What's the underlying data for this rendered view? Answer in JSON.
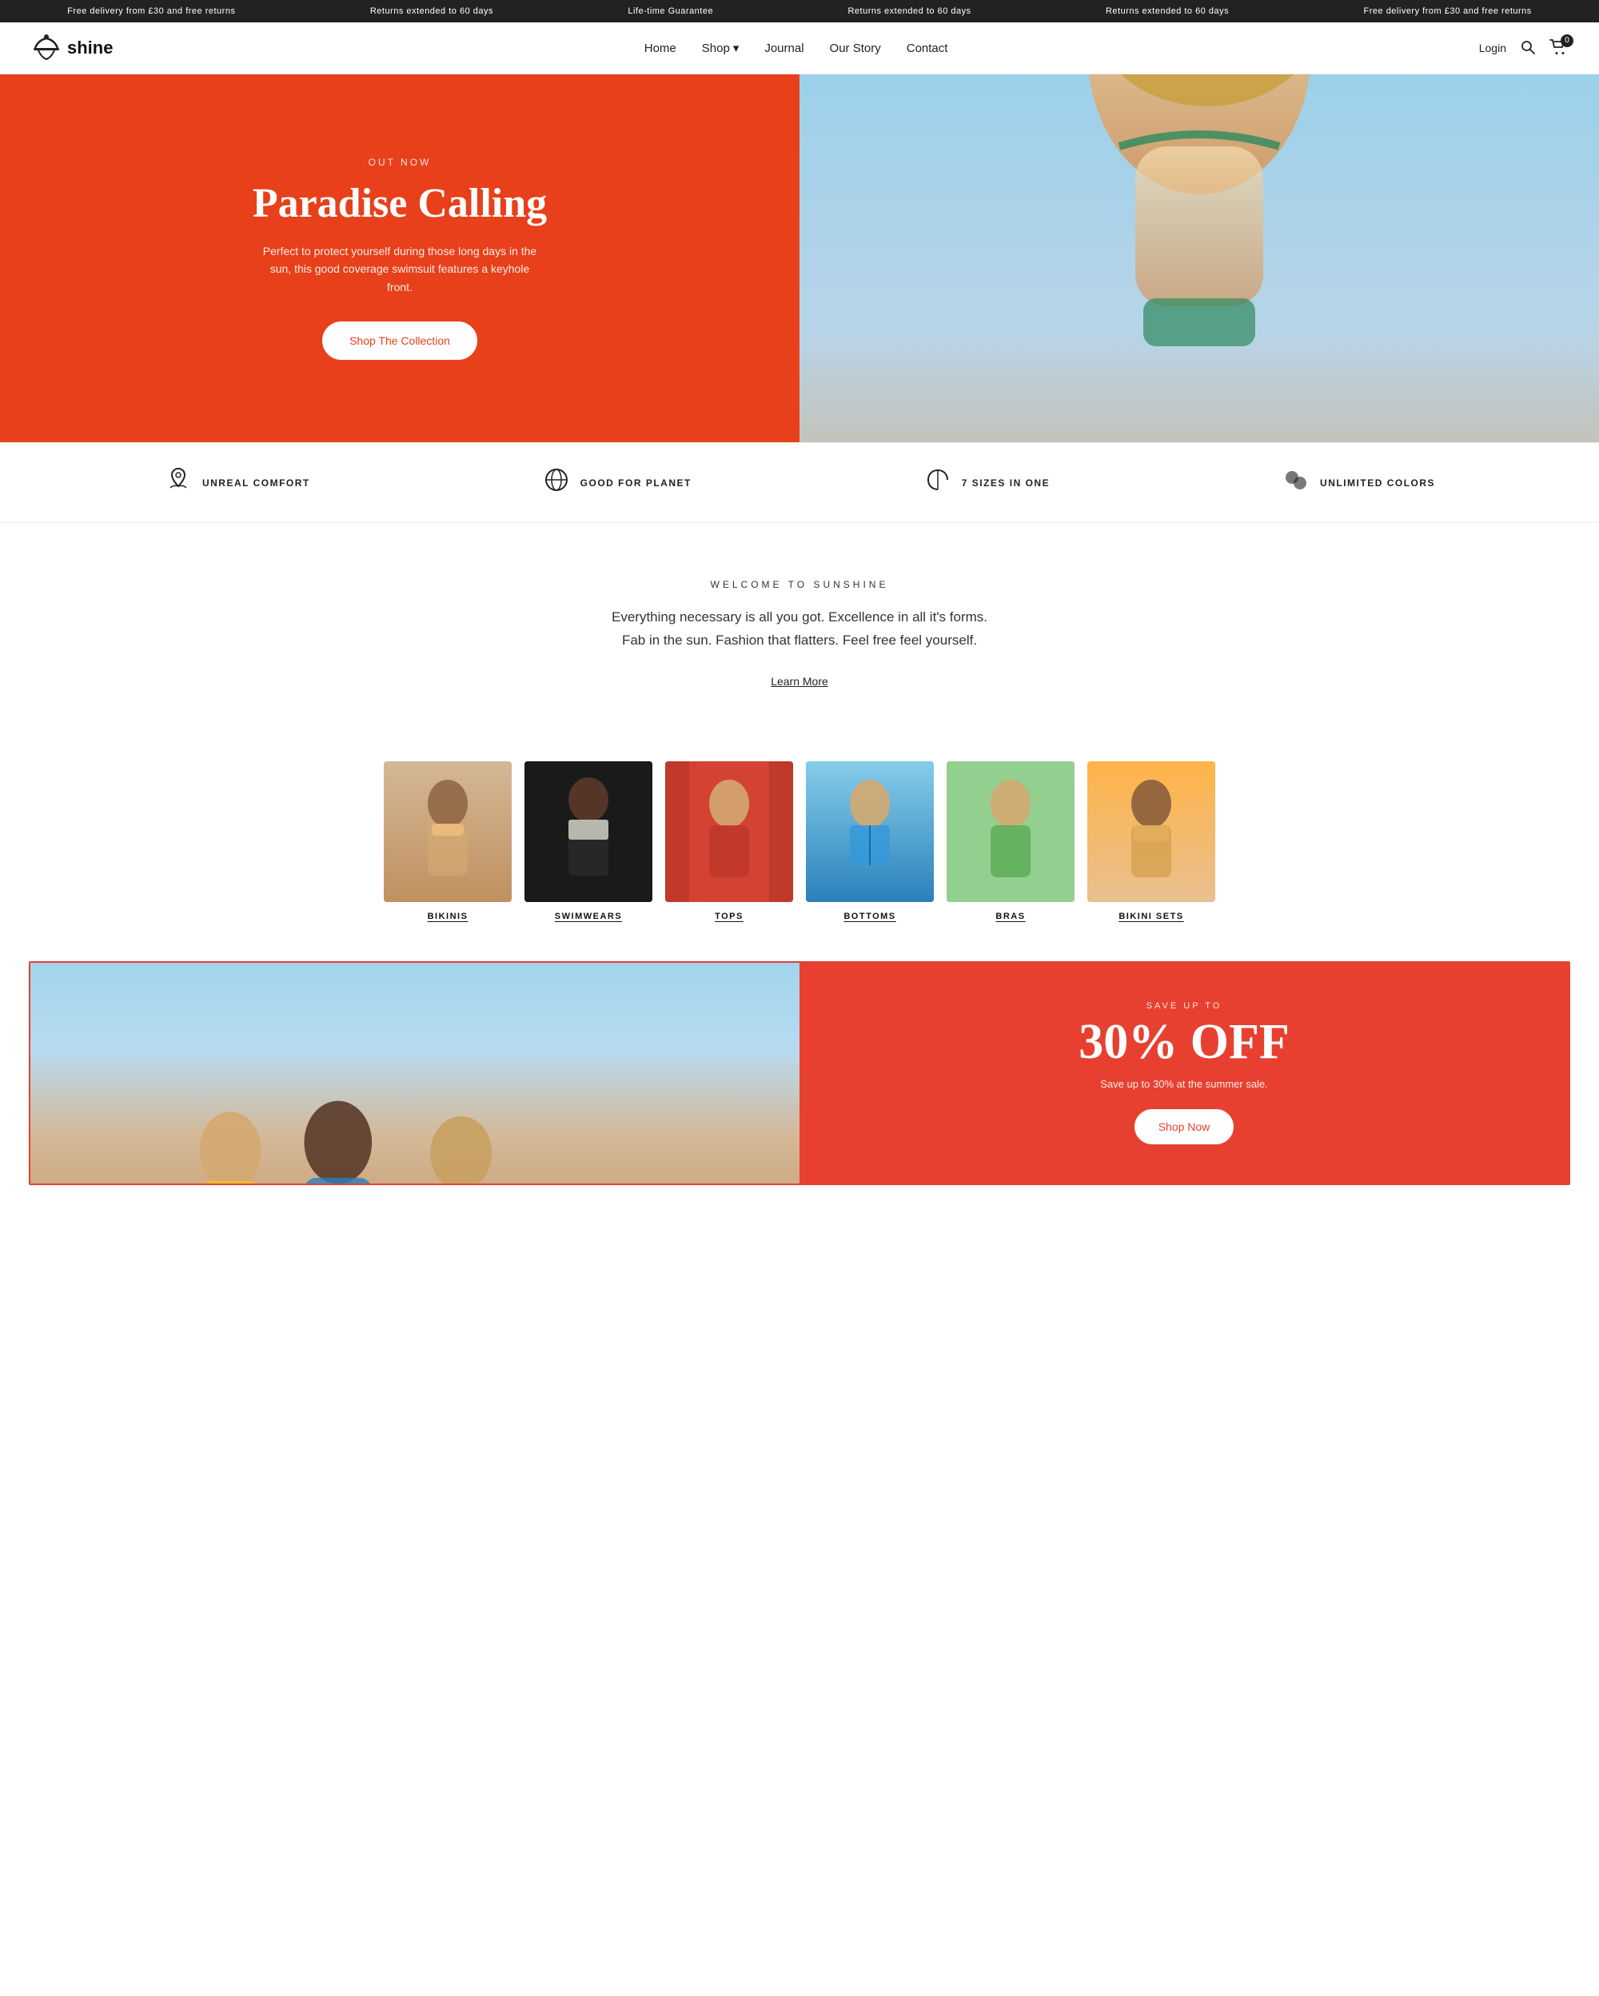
{
  "announcement_bar": {
    "items": [
      "Free delivery from £30 and free returns",
      "Returns extended to 60 days",
      "Life-time Guarantee",
      "Returns extended to 60 days",
      "Returns extended to 60 days",
      "Free delivery from £30 and free returns"
    ]
  },
  "header": {
    "logo_text": "shine",
    "cart_count": "0",
    "nav": [
      {
        "label": "Home",
        "id": "home"
      },
      {
        "label": "Shop",
        "id": "shop",
        "has_dropdown": true
      },
      {
        "label": "Journal",
        "id": "journal"
      },
      {
        "label": "Our Story",
        "id": "our-story"
      },
      {
        "label": "Contact",
        "id": "contact"
      }
    ],
    "login_label": "Login"
  },
  "hero": {
    "eyebrow": "OUT NOW",
    "title": "Paradise Calling",
    "description": "Perfect to protect yourself during those long days in the sun, this good coverage swimsuit features a keyhole front.",
    "cta_label": "Shop The Collection"
  },
  "features": [
    {
      "icon": "🧘",
      "label": "UNREAL COMFORT",
      "id": "comfort"
    },
    {
      "icon": "🌍",
      "label": "GOOD FOR PLANET",
      "id": "planet"
    },
    {
      "icon": "✂",
      "label": "7 SIZES IN ONE",
      "id": "sizes"
    },
    {
      "icon": "⬤",
      "label": "UNLIMITED COLORS",
      "id": "colors"
    }
  ],
  "welcome": {
    "eyebrow": "WELCOME TO SUNSHINE",
    "body_line1": "Everything necessary is all you got. Excellence in all it's forms.",
    "body_line2": "Fab in the sun. Fashion that flatters. Feel free feel yourself.",
    "learn_more_label": "Learn More"
  },
  "categories": [
    {
      "id": "bikinis",
      "label": "BIKINIS",
      "color_class": "cat-bikini"
    },
    {
      "id": "swimwears",
      "label": "SWIMWEARS",
      "color_class": "cat-swimwear"
    },
    {
      "id": "tops",
      "label": "TOPS",
      "color_class": "cat-tops"
    },
    {
      "id": "bottoms",
      "label": "BOTTOMS",
      "color_class": "cat-bottoms"
    },
    {
      "id": "bras",
      "label": "BRAS",
      "color_class": "cat-bras"
    },
    {
      "id": "bikini-sets",
      "label": "BIKINI SETS",
      "color_class": "cat-bikini-sets"
    }
  ],
  "promo": {
    "eyebrow": "SAVE UP TO",
    "title": "30% OFF",
    "subtitle": "Save up to 30% at the summer sale.",
    "cta_label": "Shop Now"
  }
}
